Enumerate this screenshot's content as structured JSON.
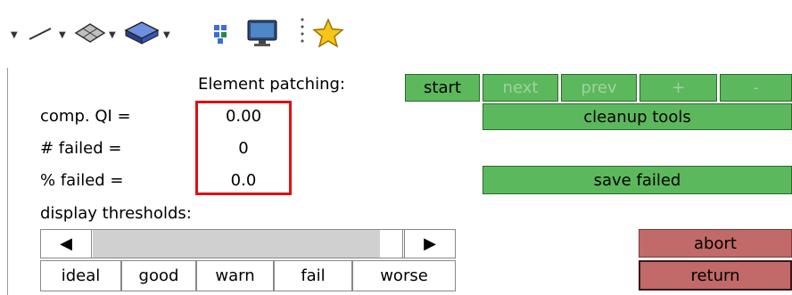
{
  "toolbar": {
    "icons": [
      "line-icon",
      "surface-icon",
      "solid-icon",
      "elements-icon",
      "display-icon",
      "star-icon"
    ]
  },
  "patching": {
    "label": "Element patching:",
    "buttons": {
      "start": "start",
      "next": "next",
      "prev": "prev",
      "plus": "+",
      "minus": "-"
    }
  },
  "stats": {
    "comp_qi_label": "comp. QI =",
    "comp_qi_value": "0.00",
    "failed_count_label": "# failed =",
    "failed_count_value": "0",
    "failed_pct_label": "% failed =",
    "failed_pct_value": "0.0"
  },
  "buttons": {
    "cleanup": "cleanup tools",
    "save_failed": "save failed",
    "abort": "abort",
    "return": "return"
  },
  "thresholds": {
    "label": "display thresholds:",
    "items": [
      "ideal",
      "good",
      "warn",
      "fail",
      "worse"
    ]
  },
  "colors": {
    "green_button": "#5cb85c",
    "red_button": "#c26969",
    "highlight": "#e01010"
  }
}
